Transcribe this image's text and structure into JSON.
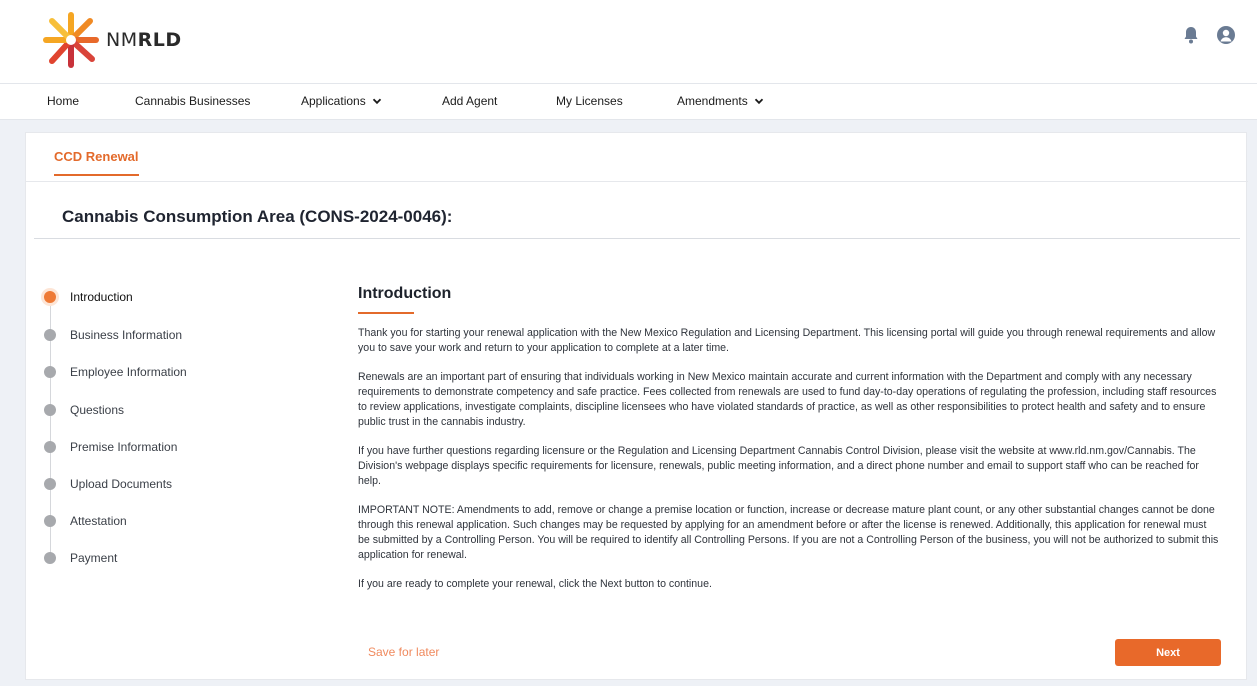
{
  "header": {
    "logo_text_thin": "NM",
    "logo_text_bold": "RLD",
    "colors": {
      "accent": "#e36a2b",
      "logo_orange": "#f5a623",
      "logo_red": "#d9443a"
    }
  },
  "nav": {
    "items": [
      {
        "label": "Home"
      },
      {
        "label": "Cannabis Businesses"
      },
      {
        "label": "Applications"
      },
      {
        "label": "Add Agent"
      },
      {
        "label": "My Licenses"
      },
      {
        "label": "Amendments"
      }
    ]
  },
  "tab": {
    "label": "CCD Renewal"
  },
  "page": {
    "title": "Cannabis Consumption Area (CONS-2024-0046):"
  },
  "steps": [
    {
      "label": "Introduction",
      "active": true
    },
    {
      "label": "Business Information"
    },
    {
      "label": "Employee Information"
    },
    {
      "label": "Questions"
    },
    {
      "label": "Premise Information"
    },
    {
      "label": "Upload Documents"
    },
    {
      "label": "Attestation"
    },
    {
      "label": "Payment"
    }
  ],
  "content": {
    "heading": "Introduction",
    "paragraphs": [
      "Thank you for starting your renewal application with the New Mexico Regulation and Licensing Department. This licensing portal will guide you through renewal requirements and allow you to save your work and return to your application to complete at a later time.",
      "Renewals are an important part of ensuring that individuals working in New Mexico maintain accurate and current information with the Department and comply with any necessary requirements to demonstrate competency and safe practice. Fees collected from renewals are used to fund day-to-day operations of regulating the profession, including staff resources to review applications, investigate complaints, discipline licensees who have violated standards of practice, as well as other responsibilities to protect health and safety and to ensure public trust in the cannabis industry.",
      "If you have further questions regarding licensure or the Regulation and Licensing Department Cannabis Control Division, please visit the website at www.rld.nm.gov/Cannabis. The Division's webpage displays specific requirements for licensure, renewals, public meeting information, and a direct phone number and email to support staff who can be reached for help.",
      "IMPORTANT NOTE: Amendments to add, remove or change a premise location or function, increase or decrease mature plant count, or any other substantial changes cannot be done through this renewal application. Such changes may be requested by applying for an amendment before or after the license is renewed. Additionally, this application for renewal must be submitted by a Controlling Person. You will be required to identify all Controlling Persons. If you are not a Controlling Person of the business, you will not be authorized to submit this application for renewal.",
      "If you are ready to complete your renewal, click the Next button to continue."
    ]
  },
  "actions": {
    "save_label": "Save for later",
    "next_label": "Next"
  }
}
